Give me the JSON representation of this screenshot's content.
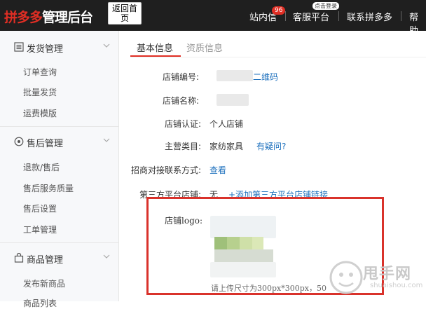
{
  "header": {
    "logo_brand": "拼多多",
    "logo_rest": "管理后台",
    "back_label": "返回首页",
    "nav_messages": "站内信",
    "messages_badge": "96",
    "nav_service": "客服平台",
    "service_tip": "点击登录",
    "nav_contact": "联系拼多多",
    "nav_help": "帮助"
  },
  "sidebar": {
    "groups": [
      {
        "label": "发货管理",
        "icon": "list-icon",
        "items": [
          "订单查询",
          "批量发货",
          "运费模版"
        ]
      },
      {
        "label": "售后管理",
        "icon": "aftersale-icon",
        "items": [
          "退款/售后",
          "售后服务质量",
          "售后设置",
          "工单管理"
        ]
      },
      {
        "label": "商品管理",
        "icon": "bag-icon",
        "items": [
          "发布新商品",
          "商品列表"
        ]
      }
    ]
  },
  "tabs": [
    {
      "label": "基本信息",
      "active": true
    },
    {
      "label": "资质信息",
      "active": false
    }
  ],
  "form": {
    "shop_id_label": "店铺编号:",
    "shop_id_link": "二维码",
    "shop_name_label": "店铺名称:",
    "cert_label": "店铺认证:",
    "cert_value": "个人店铺",
    "category_label": "主营类目:",
    "category_value": "家纺家具",
    "category_link": "有疑问?",
    "contact_label": "招商对接联系方式:",
    "contact_link": "查看",
    "third_party_label": "第三方平台店铺:",
    "third_party_value": "无",
    "third_party_link": "+添加第三方平台店铺链接",
    "logo_label": "店铺logo:",
    "logo_hint": "请上传尺寸为300px*300px，50"
  },
  "watermark": {
    "text": "甩手网",
    "sub": "shuaishou.com"
  },
  "colors": {
    "brand": "#e02e24",
    "link": "#1b6fbd",
    "highlight": "#d9322b"
  }
}
